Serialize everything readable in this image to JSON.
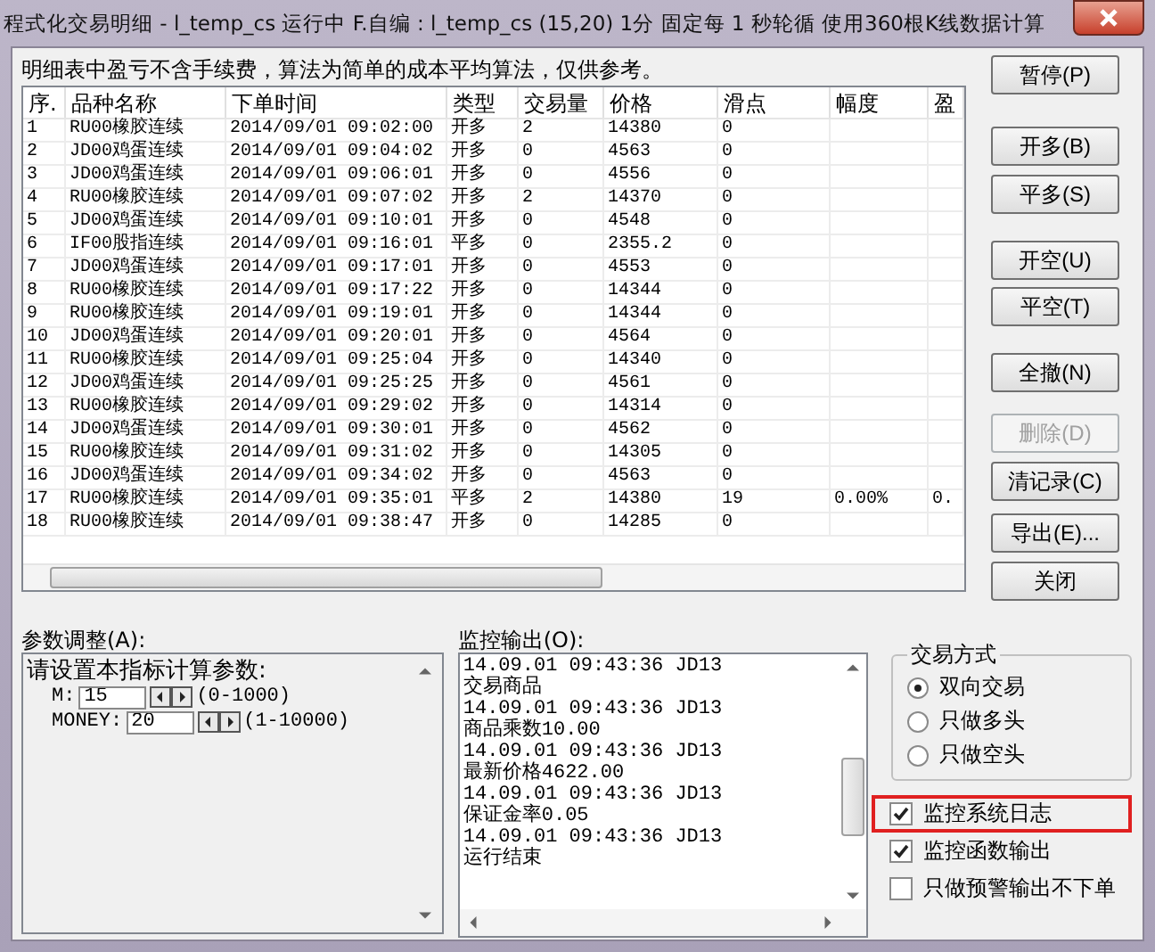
{
  "window": {
    "title": "程式化交易明细 - l_temp_cs 运行中  F.自编 : l_temp_cs (15,20) 1分 固定每 1 秒轮循 使用360根K线数据计算"
  },
  "notice": "明细表中盈亏不含手续费，算法为简单的成本平均算法，仅供参考。",
  "table": {
    "columns": [
      "序.",
      "品种名称",
      "下单时间",
      "类型",
      "交易量",
      "价格",
      "滑点",
      "幅度",
      "盈"
    ],
    "rows": [
      [
        "1",
        "RU00橡胶连续",
        "2014/09/01 09:02:00",
        "开多",
        "2",
        "14380",
        "0",
        "",
        ""
      ],
      [
        "2",
        "JD00鸡蛋连续",
        "2014/09/01 09:04:02",
        "开多",
        "0",
        "4563",
        "0",
        "",
        ""
      ],
      [
        "3",
        "JD00鸡蛋连续",
        "2014/09/01 09:06:01",
        "开多",
        "0",
        "4556",
        "0",
        "",
        ""
      ],
      [
        "4",
        "RU00橡胶连续",
        "2014/09/01 09:07:02",
        "开多",
        "2",
        "14370",
        "0",
        "",
        ""
      ],
      [
        "5",
        "JD00鸡蛋连续",
        "2014/09/01 09:10:01",
        "开多",
        "0",
        "4548",
        "0",
        "",
        ""
      ],
      [
        "6",
        "IF00股指连续",
        "2014/09/01 09:16:01",
        "平多",
        "0",
        "2355.2",
        "0",
        "",
        ""
      ],
      [
        "7",
        "JD00鸡蛋连续",
        "2014/09/01 09:17:01",
        "开多",
        "0",
        "4553",
        "0",
        "",
        ""
      ],
      [
        "8",
        "RU00橡胶连续",
        "2014/09/01 09:17:22",
        "开多",
        "0",
        "14344",
        "0",
        "",
        ""
      ],
      [
        "9",
        "RU00橡胶连续",
        "2014/09/01 09:19:01",
        "开多",
        "0",
        "14344",
        "0",
        "",
        ""
      ],
      [
        "10",
        "JD00鸡蛋连续",
        "2014/09/01 09:20:01",
        "开多",
        "0",
        "4564",
        "0",
        "",
        ""
      ],
      [
        "11",
        "RU00橡胶连续",
        "2014/09/01 09:25:04",
        "开多",
        "0",
        "14340",
        "0",
        "",
        ""
      ],
      [
        "12",
        "JD00鸡蛋连续",
        "2014/09/01 09:25:25",
        "开多",
        "0",
        "4561",
        "0",
        "",
        ""
      ],
      [
        "13",
        "RU00橡胶连续",
        "2014/09/01 09:29:02",
        "开多",
        "0",
        "14314",
        "0",
        "",
        ""
      ],
      [
        "14",
        "JD00鸡蛋连续",
        "2014/09/01 09:30:01",
        "开多",
        "0",
        "4562",
        "0",
        "",
        ""
      ],
      [
        "15",
        "RU00橡胶连续",
        "2014/09/01 09:31:02",
        "开多",
        "0",
        "14305",
        "0",
        "",
        ""
      ],
      [
        "16",
        "JD00鸡蛋连续",
        "2014/09/01 09:34:02",
        "开多",
        "0",
        "4563",
        "0",
        "",
        ""
      ],
      [
        "17",
        "RU00橡胶连续",
        "2014/09/01 09:35:01",
        "平多",
        "2",
        "14380",
        "19",
        "0.00%",
        "0."
      ],
      [
        "18",
        "RU00橡胶连续",
        "2014/09/01 09:38:47",
        "开多",
        "0",
        "14285",
        "0",
        "",
        ""
      ]
    ]
  },
  "buttons": [
    {
      "label": "暂停(P)",
      "disabled": false
    },
    {
      "label": "开多(B)",
      "disabled": false
    },
    {
      "label": "平多(S)",
      "disabled": false
    },
    {
      "label": "开空(U)",
      "disabled": false
    },
    {
      "label": "平空(T)",
      "disabled": false
    },
    {
      "label": "全撤(N)",
      "disabled": false
    },
    {
      "label": "删除(D)",
      "disabled": true
    },
    {
      "label": "清记录(C)",
      "disabled": false
    },
    {
      "label": "导出(E)...",
      "disabled": false
    },
    {
      "label": "关闭",
      "disabled": false
    }
  ],
  "params": {
    "label": "参数调整(A):",
    "heading": "请设置本指标计算参数:",
    "items": [
      {
        "name": "M:",
        "value": "15",
        "range": "(0-1000)"
      },
      {
        "name": "MONEY:",
        "value": "20",
        "range": "(1-10000)"
      }
    ]
  },
  "monitor": {
    "label": "监控输出(O):",
    "lines": [
      "14.09.01 09:43:36 JD13",
      "交易商品",
      "14.09.01 09:43:36 JD13",
      "商品乘数10.00",
      "14.09.01 09:43:36 JD13",
      "最新价格4622.00",
      "14.09.01 09:43:36 JD13",
      "保证金率0.05",
      "14.09.01 09:43:36 JD13",
      "运行结束"
    ]
  },
  "trade_mode": {
    "title": "交易方式",
    "options": [
      {
        "label": "双向交易",
        "selected": true
      },
      {
        "label": "只做多头",
        "selected": false
      },
      {
        "label": "只做空头",
        "selected": false
      }
    ]
  },
  "checkboxes": [
    {
      "label": "监控系统日志",
      "checked": true,
      "highlighted": true
    },
    {
      "label": "监控函数输出",
      "checked": true,
      "highlighted": false
    },
    {
      "label": "只做预警输出不下单",
      "checked": false,
      "highlighted": false
    }
  ]
}
